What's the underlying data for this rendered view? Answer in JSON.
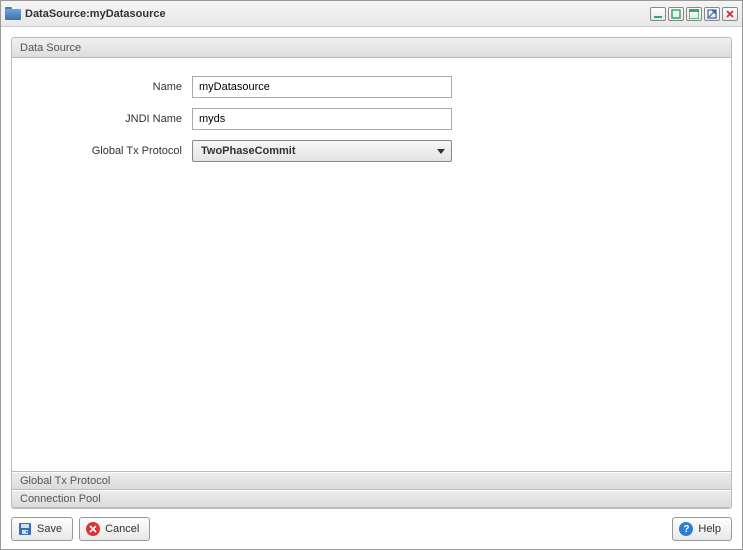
{
  "window": {
    "title": "DataSource:myDatasource"
  },
  "panel": {
    "header": "Data Source",
    "form": {
      "name_label": "Name",
      "name_value": "myDatasource",
      "jndi_label": "JNDI Name",
      "jndi_value": "myds",
      "protocol_label": "Global Tx Protocol",
      "protocol_value": "TwoPhaseCommit"
    },
    "collapsed_sections": {
      "global_tx": "Global Tx Protocol",
      "connection_pool": "Connection Pool"
    }
  },
  "footer": {
    "save": "Save",
    "cancel": "Cancel",
    "help": "Help"
  }
}
